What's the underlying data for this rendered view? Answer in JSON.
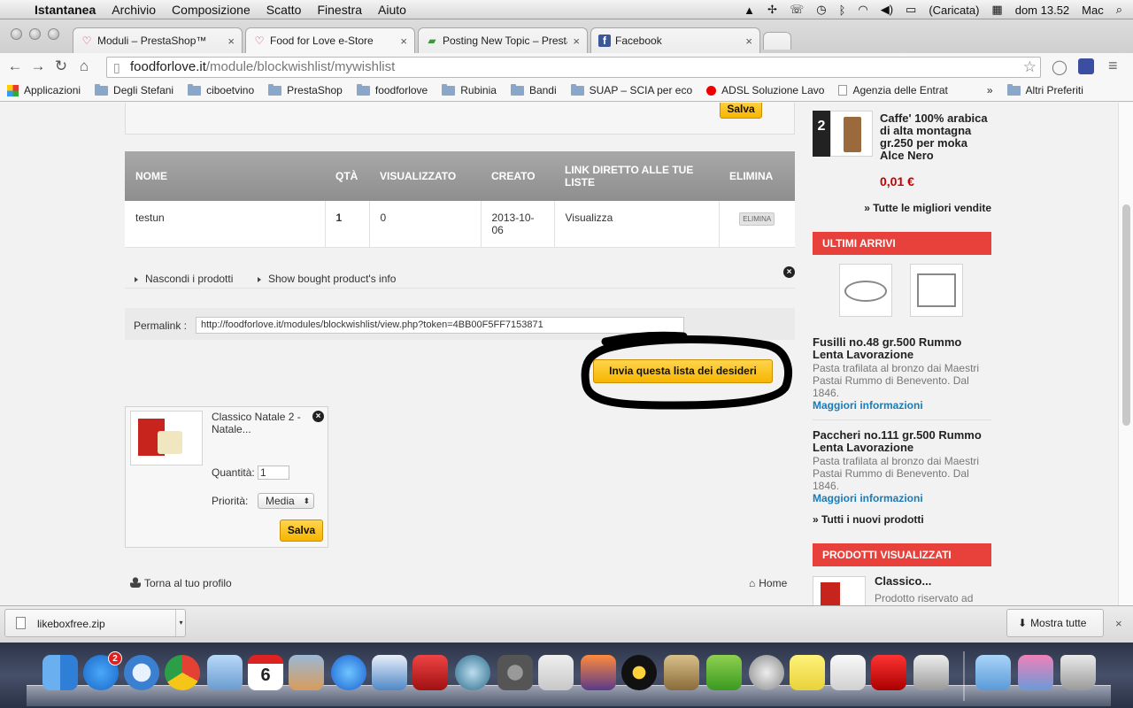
{
  "menubar": {
    "app": "Istantanea",
    "items": [
      "Archivio",
      "Composizione",
      "Scatto",
      "Finestra",
      "Aiuto"
    ],
    "battery": "(Caricata)",
    "clock": "dom 13.52",
    "user": "Mac"
  },
  "browser": {
    "tabs": [
      {
        "title": "Moduli – PrestaShop™",
        "favicon": "heart-icon"
      },
      {
        "title": "Food for Love e-Store",
        "favicon": "heart-icon"
      },
      {
        "title": "Posting New Topic – Presta",
        "favicon": "forum-icon"
      },
      {
        "title": "Facebook",
        "favicon": "facebook-icon"
      }
    ],
    "url_host": "foodforlove.it",
    "url_path": "/module/blockwishlist/mywishlist",
    "bookmarks": [
      "Applicazioni",
      "Degli Stefani",
      "ciboetvino",
      "PrestaShop",
      "foodforlove",
      "Rubinia",
      "Bandi",
      "SUAP – SCIA per eco",
      "ADSL Soluzione Lavo",
      "Agenzia delle Entrat"
    ],
    "bookmarks_more": "»",
    "bookmarks_other": "Altri Preferiti"
  },
  "page": {
    "top_save": "Salva",
    "table": {
      "headers": [
        "NOME",
        "QTÀ",
        "VISUALIZZATO",
        "CREATO",
        "LINK DIRETTO ALLE TUE LISTE",
        "ELIMINA"
      ],
      "row": {
        "name": "testun",
        "qty": "1",
        "viewed": "0",
        "created": "2013-10-06",
        "link": "Visualizza",
        "delete": "ELIMINA"
      }
    },
    "hide_products": "Nascondi i prodotti",
    "show_bought": "Show bought product's info",
    "permalink_label": "Permalink :",
    "permalink_value": "http://foodforlove.it/modules/blockwishlist/view.php?token=4BB00F5FF7153871",
    "send_button": "Invia questa lista dei desideri",
    "product": {
      "name": "Classico Natale 2 - Natale...",
      "qty_label": "Quantità:",
      "qty_value": "1",
      "priority_label": "Priorità:",
      "priority_value": "Media",
      "save": "Salva"
    },
    "back_profile": "Torna al tuo profilo",
    "home": "Home"
  },
  "sidebar": {
    "best_rank": "2",
    "best_name": "Caffe' 100% arabica di alta montagna gr.250 per moka Alce Nero",
    "best_price": "0,01 €",
    "all_best": "» Tutte le migliori vendite",
    "new_title": "ULTIMI ARRIVI",
    "new_products": [
      {
        "name": "Fusilli no.48 gr.500 Rummo Lenta Lavorazione",
        "desc": "Pasta trafilata al bronzo dai Maestri Pastai Rummo di Benevento. Dal 1846.",
        "more": "Maggiori informazioni"
      },
      {
        "name": "Paccheri no.111 gr.500 Rummo Lenta Lavorazione",
        "desc": "Pasta trafilata al bronzo dai Maestri Pastai Rummo di Benevento. Dal 1846.",
        "more": "Maggiori informazioni"
      }
    ],
    "all_new": "» Tutti i nuovi prodotti",
    "viewed_title": "PRODOTTI VISUALIZZATI",
    "viewed_name": "Classico...",
    "viewed_desc": "Prodotto riservato ad"
  },
  "download": {
    "file": "likeboxfree.zip",
    "show_all": "Mostra tutte"
  },
  "dock": {
    "appstore_badge": "2",
    "calendar_day": "6"
  },
  "colors": {
    "accent_red": "#e8403a",
    "button_yellow": "#f7b500",
    "link_blue": "#1a7bb8",
    "price_red": "#c40000"
  }
}
